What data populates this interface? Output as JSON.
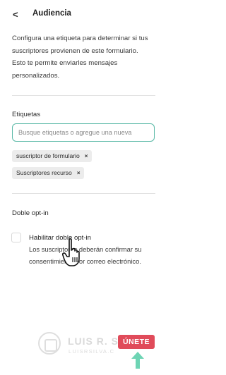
{
  "header": {
    "back_glyph": "<",
    "title": "Audiencia"
  },
  "description": {
    "lines": [
      "Configura una etiqueta para determinar si tus",
      "suscriptores provienen de este formulario.",
      "Esto te permite enviarles mensajes",
      "personalizados."
    ]
  },
  "tags_section": {
    "label": "Etiquetas",
    "search_placeholder": "Busque etiquetas o agregue una nueva",
    "search_value": "",
    "tags": [
      {
        "label": "suscriptor de formulario",
        "remove_glyph": "×"
      },
      {
        "label": "Suscriptores recurso",
        "remove_glyph": "×"
      }
    ]
  },
  "double_optin": {
    "label": "Doble opt-in",
    "checkbox_checked": false,
    "option_title": "Habilitar doble opt-in",
    "option_desc_lines": [
      "Los suscriptores deberán confirmar su",
      "consentimiento por correo electrónico."
    ]
  },
  "watermark": {
    "name": "LUIS R. S",
    "url": "LUISRSILVA.C",
    "join_label": "ÚNETE",
    "icons": [
      "logo-icon",
      "up-arrow-icon",
      "hand-cursor-icon"
    ]
  },
  "colors": {
    "accent_border": "#58b8a6",
    "tag_bg": "#ececec",
    "join_badge": "#e04b5a",
    "arrow": "#6ed4b4"
  }
}
